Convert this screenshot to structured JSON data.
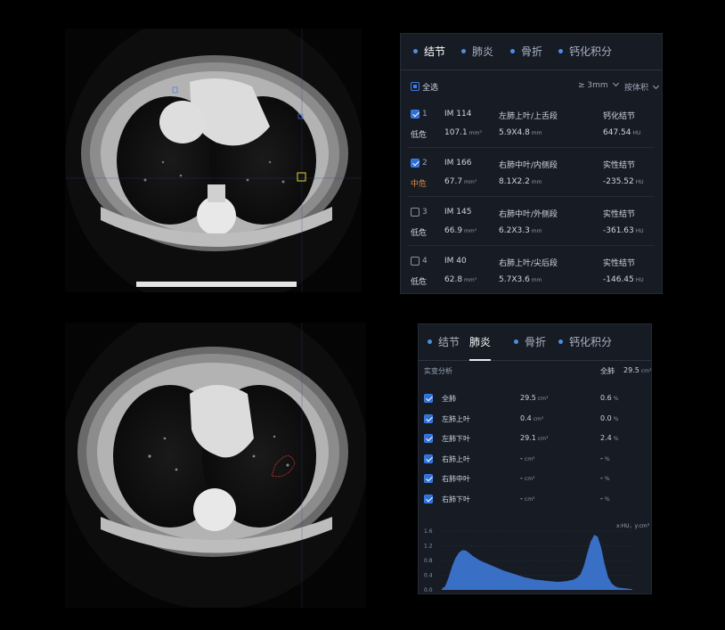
{
  "panel1": {
    "tabs": [
      "结节",
      "肺炎",
      "骨折",
      "钙化积分"
    ],
    "active_tab": 0,
    "select_all": "全选",
    "filter_size": "≥ 3mm",
    "sort_by": "按体积",
    "nodules": [
      {
        "index": "1",
        "image": "IM 114",
        "location": "左肺上叶/上舌段",
        "type": "钙化结节",
        "risk": "低危",
        "volume": "107.1",
        "volume_unit": "mm³",
        "size": "5.9X4.8",
        "size_unit": "mm",
        "density": "647.54",
        "density_unit": "HU",
        "checked": true
      },
      {
        "index": "2",
        "image": "IM 166",
        "location": "右肺中叶/内侧段",
        "type": "实性结节",
        "risk": "中危",
        "volume": "67.7",
        "volume_unit": "mm³",
        "size": "8.1X2.2",
        "size_unit": "mm",
        "density": "-235.52",
        "density_unit": "HU",
        "checked": true
      },
      {
        "index": "3",
        "image": "IM 145",
        "location": "右肺中叶/外侧段",
        "type": "实性结节",
        "risk": "低危",
        "volume": "66.9",
        "volume_unit": "mm³",
        "size": "6.2X3.3",
        "size_unit": "mm",
        "density": "-361.63",
        "density_unit": "HU",
        "checked": false
      },
      {
        "index": "4",
        "image": "IM 40",
        "location": "右肺上叶/尖后段",
        "type": "实性结节",
        "risk": "低危",
        "volume": "62.8",
        "volume_unit": "mm³",
        "size": "5.7X3.6",
        "size_unit": "mm",
        "density": "-146.45",
        "density_unit": "HU",
        "checked": false
      }
    ]
  },
  "panel2": {
    "tabs": [
      "结节",
      "肺炎",
      "骨折",
      "钙化积分"
    ],
    "active_tab": 1,
    "section_title": "实变分析",
    "total_label": "全肺",
    "total_value": "29.5",
    "total_unit": "cm³",
    "rows": [
      {
        "name": "全肺",
        "volume": "29.5",
        "volume_unit": "cm³",
        "pct": "0.6",
        "pct_unit": "%",
        "checked": true
      },
      {
        "name": "左肺上叶",
        "volume": "0.4",
        "volume_unit": "cm³",
        "pct": "0.0",
        "pct_unit": "%",
        "checked": true
      },
      {
        "name": "左肺下叶",
        "volume": "29.1",
        "volume_unit": "cm³",
        "pct": "2.4",
        "pct_unit": "%",
        "checked": true
      },
      {
        "name": "右肺上叶",
        "volume": "-",
        "volume_unit": "cm³",
        "pct": "-",
        "pct_unit": "%",
        "checked": true
      },
      {
        "name": "右肺中叶",
        "volume": "-",
        "volume_unit": "cm³",
        "pct": "-",
        "pct_unit": "%",
        "checked": true
      },
      {
        "name": "右肺下叶",
        "volume": "-",
        "volume_unit": "cm³",
        "pct": "-",
        "pct_unit": "%",
        "checked": true
      }
    ],
    "chart_axis_label": "x:HU，y:cm³"
  },
  "chart_data": {
    "type": "area",
    "title": "",
    "xlabel": "HU",
    "ylabel": "cm³",
    "yticks": [
      "1.6",
      "1.2",
      "0.8",
      "0.4",
      "0.0"
    ],
    "ylim": [
      0,
      1.6
    ],
    "x": [
      0,
      4,
      8,
      12,
      16,
      20,
      24,
      28,
      32,
      36,
      40,
      44,
      48,
      52,
      56,
      60,
      64,
      68,
      72,
      76,
      80,
      84,
      88,
      92,
      96,
      100,
      104,
      108,
      112,
      116,
      120,
      124,
      128,
      132,
      136,
      140,
      144,
      148,
      152,
      156,
      160,
      164,
      168,
      172,
      176,
      180,
      184,
      188,
      192,
      196,
      200,
      204,
      208,
      212,
      216,
      220
    ],
    "series": [
      {
        "values": [
          0.03,
          0.1,
          0.35,
          0.65,
          0.88,
          1.02,
          1.08,
          1.07,
          1.0,
          0.92,
          0.86,
          0.8,
          0.76,
          0.72,
          0.68,
          0.64,
          0.6,
          0.56,
          0.52,
          0.49,
          0.46,
          0.43,
          0.4,
          0.37,
          0.34,
          0.32,
          0.3,
          0.28,
          0.27,
          0.26,
          0.25,
          0.24,
          0.23,
          0.22,
          0.22,
          0.23,
          0.24,
          0.26,
          0.28,
          0.33,
          0.42,
          0.65,
          1.0,
          1.32,
          1.5,
          1.45,
          1.15,
          0.7,
          0.35,
          0.18,
          0.1,
          0.06,
          0.05,
          0.04,
          0.03,
          0.02
        ],
        "color": "#3a6fc6"
      }
    ],
    "grid": true
  }
}
